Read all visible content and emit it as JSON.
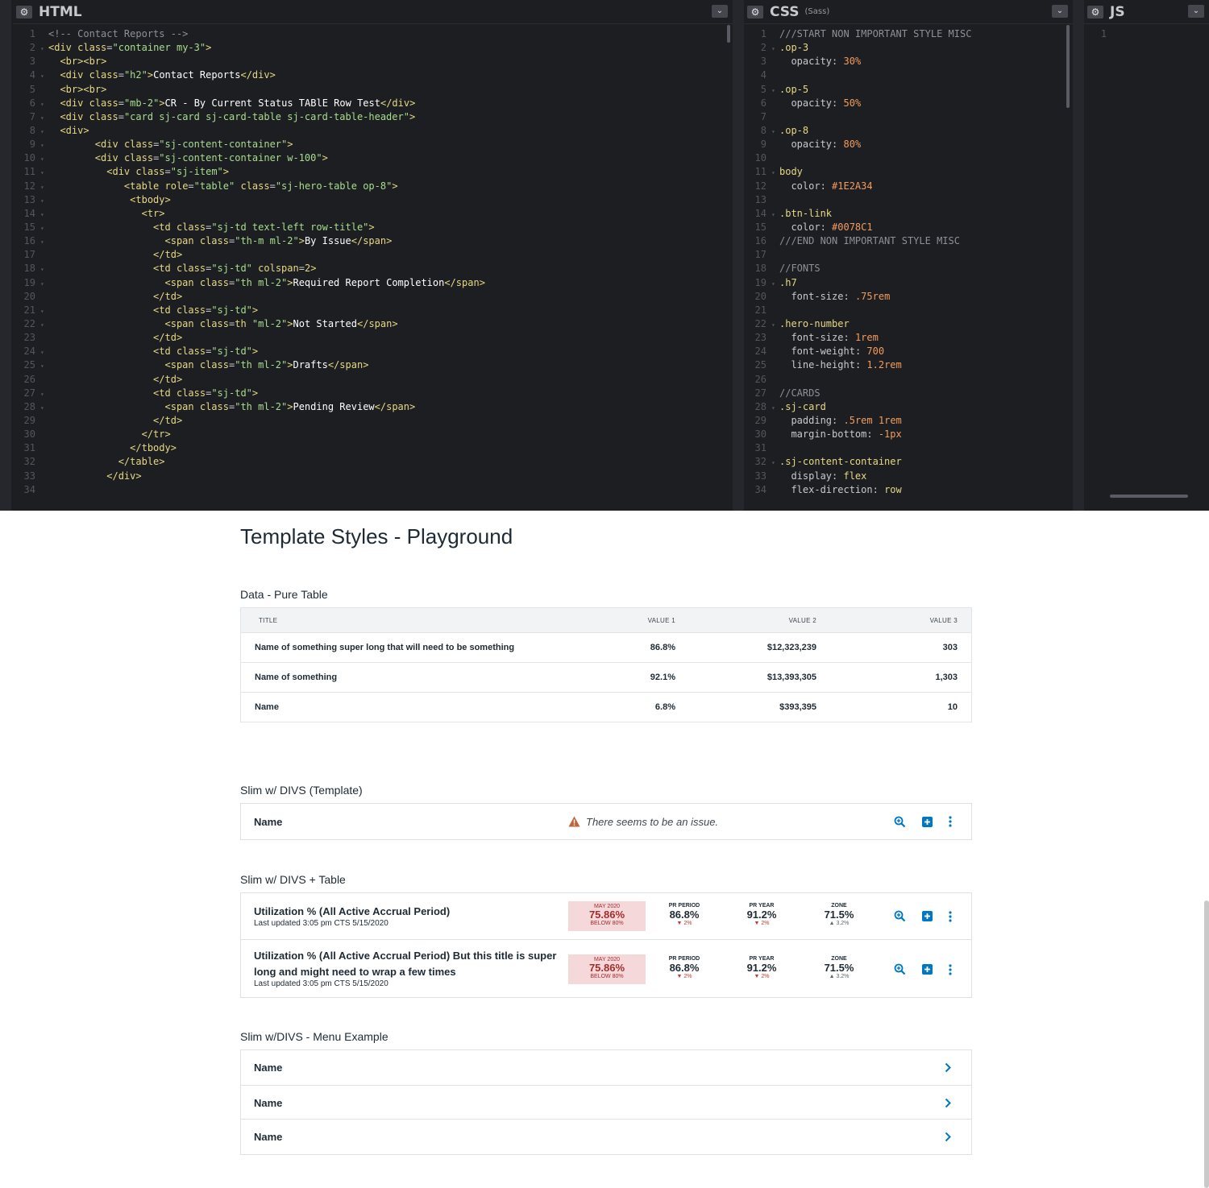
{
  "editor": {
    "html_pane": {
      "title": "HTML",
      "line_numbers": [
        "1",
        "2",
        "3",
        "4",
        "5",
        "6",
        "7",
        "8",
        "9",
        "10",
        "11",
        "12",
        "13",
        "14",
        "15",
        "16",
        "17",
        "18",
        "19",
        "20",
        "21",
        "22",
        "23",
        "24",
        "25",
        "26",
        "27",
        "28",
        "29",
        "30",
        "31",
        "32",
        "33",
        "34"
      ]
    },
    "css_pane": {
      "title": "CSS",
      "subtitle": "(Sass)",
      "line_numbers": [
        "1",
        "2",
        "3",
        "4",
        "5",
        "6",
        "7",
        "8",
        "9",
        "10",
        "11",
        "12",
        "13",
        "14",
        "15",
        "16",
        "17",
        "18",
        "19",
        "20",
        "21",
        "22",
        "23",
        "24",
        "25",
        "26",
        "27",
        "28",
        "29",
        "30",
        "31",
        "32",
        "33",
        "34"
      ]
    },
    "js_pane": {
      "title": "JS",
      "line_numbers": [
        "1"
      ]
    },
    "gear_glyph": "⚙",
    "chevron_glyph": "⌄"
  },
  "html_code": [
    "<!-- Contact Reports -->",
    "<div class=\"container my-3\">",
    "  <br><br>",
    "  <div class=\"h2\">Contact Reports</div>",
    "  <br><br>",
    "  <div class=\"mb-2\">CR - By Current Status TABlE Row Test</div>",
    "  <div class=\"card sj-card sj-card-table sj-card-table-header\">",
    "  <div>",
    "        <div class=\"sj-content-container\">",
    "        <div class=\"sj-content-container w-100\">",
    "          <div class=\"sj-item\">",
    "             <table role=\"table\" class=\"sj-hero-table op-8\">",
    "              <tbody>",
    "                <tr>",
    "                  <td class=\"sj-td text-left row-title\">",
    "                    <span class=\"th-m ml-2\">By Issue</span>",
    "                  </td>",
    "                  <td class=\"sj-td\" colspan=2>",
    "                    <span class=\"th ml-2\">Required Report Completion</span>",
    "                  </td>",
    "                  <td class=\"sj-td\">",
    "                    <span class=th \"ml-2\">Not Started</span>",
    "                  </td>",
    "                  <td class=\"sj-td\">",
    "                    <span class=\"th ml-2\">Drafts</span>",
    "                  </td>",
    "                  <td class=\"sj-td\">",
    "                    <span class=\"th ml-2\">Pending Review</span>",
    "                  </td>",
    "                </tr>",
    "              </tbody>",
    "            </table>",
    "          </div>",
    ""
  ],
  "css_code": [
    "///START NON IMPORTANT STYLE MISC",
    ".op-3",
    "  opacity: 30%",
    "",
    ".op-5",
    "  opacity: 50%",
    "",
    ".op-8",
    "  opacity: 80%",
    "",
    "body",
    "  color: #1E2A34",
    "",
    ".btn-link",
    "  color: #0078C1",
    "///END NON IMPORTANT STYLE MISC",
    "",
    "//FONTS",
    ".h7",
    "  font-size: .75rem",
    "",
    ".hero-number",
    "  font-size: 1rem",
    "  font-weight: 700",
    "  line-height: 1.2rem",
    "",
    "//CARDS",
    ".sj-card",
    "  padding: .5rem 1rem",
    "  margin-bottom: -1px",
    "",
    ".sj-content-container",
    "  display: flex",
    "  flex-direction: row"
  ],
  "preview": {
    "page_title": "Template Styles - Playground",
    "pure_table": {
      "label": "Data - Pure Table",
      "headers": [
        "TITLE",
        "VALUE 1",
        "VALUE 2",
        "VALUE 3"
      ],
      "rows": [
        {
          "title": "Name of something super long that will need to be something",
          "v1": "86.8%",
          "v2": "$12,323,239",
          "v3": "303"
        },
        {
          "title": "Name of something",
          "v1": "92.1%",
          "v2": "$13,393,305",
          "v3": "1,303"
        },
        {
          "title": "Name",
          "v1": "6.8%",
          "v2": "$393,395",
          "v3": "10"
        }
      ]
    },
    "slim_template": {
      "label": "Slim w/ DIVS (Template)",
      "name": "Name",
      "issue": "There seems to be an issue."
    },
    "slim_table": {
      "label": "Slim w/ DIVS + Table",
      "rows": [
        {
          "title": "Utilization % (All Active Accrual Period)",
          "updated": "Last updated 3:05 pm CTS 5/15/2020",
          "alert": {
            "label": "MAY 2020",
            "value": "75.86%",
            "sub": "BELOW 80%"
          },
          "stats": [
            {
              "label": "PR PERIOD",
              "value": "86.8%",
              "change": "▼ 2%",
              "dir": "down"
            },
            {
              "label": "PR YEAR",
              "value": "91.2%",
              "change": "▼ 2%",
              "dir": "down"
            },
            {
              "label": "ZONE",
              "value": "71.5%",
              "change": "▲ 3.2%",
              "dir": "up"
            }
          ]
        },
        {
          "title": "Utilization % (All Active Accrual Period) But this title is super long and might need to wrap a few times",
          "updated": "Last updated 3:05 pm CTS 5/15/2020",
          "alert": {
            "label": "MAY 2020",
            "value": "75.86%",
            "sub": "BELOW 80%"
          },
          "stats": [
            {
              "label": "PR PERIOD",
              "value": "86.8%",
              "change": "▼ 2%",
              "dir": "down"
            },
            {
              "label": "PR YEAR",
              "value": "91.2%",
              "change": "▼ 2%",
              "dir": "down"
            },
            {
              "label": "ZONE",
              "value": "71.5%",
              "change": "▲ 3.2%",
              "dir": "up"
            }
          ]
        }
      ]
    },
    "menu": {
      "label": "Slim w/DIVS - Menu Example",
      "items": [
        "Name",
        "Name",
        "Name"
      ]
    },
    "colors": {
      "link": "#0078C1",
      "text": "#1E2A34",
      "alert_bg": "#f5d9da",
      "alert_text": "#a32d2d",
      "warn_icon": "#c0653a",
      "down": "#c0392b",
      "up": "#5b6770"
    }
  }
}
